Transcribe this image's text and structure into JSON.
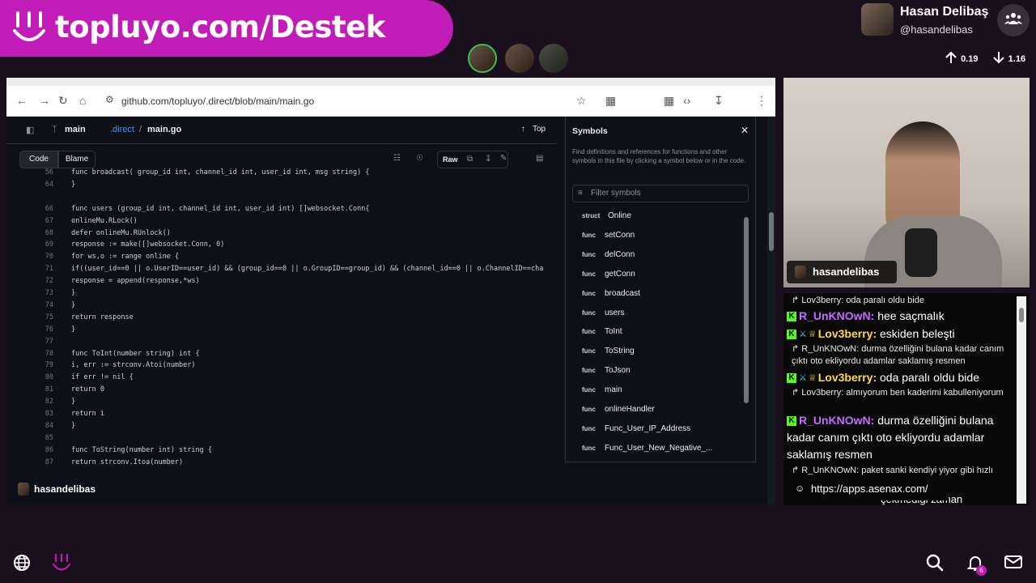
{
  "banner": {
    "text": "topluyo.com/Destek",
    "logo_icon": "topluyo-smile-icon"
  },
  "streamer": {
    "name": "Hasan Delibaş",
    "handle": "@hasandelibas"
  },
  "stats": {
    "upload": "0.19",
    "download": "1.16"
  },
  "browser": {
    "url": "github.com/topluyo/.direct/blob/main/main.go",
    "breadcrumb_repo": ".direct",
    "breadcrumb_file": "main.go",
    "branch": "main",
    "top_label": "Top",
    "code_tab": "Code",
    "blame_tab": "Blame",
    "raw_label": "Raw",
    "code_lines": [
      {
        "n": "56",
        "t": "func broadcast( group_id int, channel_id int, user_id int, msg string) {"
      },
      {
        "n": "64",
        "t": "}"
      },
      {
        "n": "",
        "t": ""
      },
      {
        "n": "66",
        "t": "func users (group_id int, channel_id int, user_id int) []websocket.Conn{"
      },
      {
        "n": "67",
        "t": "    onlineMu.RLock()"
      },
      {
        "n": "68",
        "t": "    defer onlineMu.RUnlock()"
      },
      {
        "n": "69",
        "t": "    response := make([]websocket.Conn, 0)"
      },
      {
        "n": "70",
        "t": "    for ws,o := range online {"
      },
      {
        "n": "71",
        "t": "        if((user_id==0 || o.UserID==user_id) && (group_id==0 || o.GroupID==group_id) && (channel_id==0 || o.ChannelID==cha"
      },
      {
        "n": "72",
        "t": "            response = append(response,*ws)"
      },
      {
        "n": "73",
        "t": "        }"
      },
      {
        "n": "74",
        "t": "    }"
      },
      {
        "n": "75",
        "t": "    return response"
      },
      {
        "n": "76",
        "t": "}"
      },
      {
        "n": "77",
        "t": ""
      },
      {
        "n": "78",
        "t": "func ToInt(number string) int {"
      },
      {
        "n": "79",
        "t": "    i, err := strconv.Atoi(number)"
      },
      {
        "n": "80",
        "t": "    if err != nil {"
      },
      {
        "n": "81",
        "t": "        return 0"
      },
      {
        "n": "82",
        "t": "    }"
      },
      {
        "n": "83",
        "t": "    return i"
      },
      {
        "n": "84",
        "t": "}"
      },
      {
        "n": "85",
        "t": ""
      },
      {
        "n": "86",
        "t": "func ToString(number int) string {"
      },
      {
        "n": "87",
        "t": "    return strconv.Itoa(number)"
      }
    ],
    "symbols": {
      "title": "Symbols",
      "description": "Find definitions and references for functions and other symbols in this file by clicking a symbol below or in the code.",
      "filter_placeholder": "Filter symbols",
      "items": [
        {
          "kind": "struct",
          "name": "Online"
        },
        {
          "kind": "func",
          "name": "setConn"
        },
        {
          "kind": "func",
          "name": "delConn"
        },
        {
          "kind": "func",
          "name": "getConn"
        },
        {
          "kind": "func",
          "name": "broadcast"
        },
        {
          "kind": "func",
          "name": "users"
        },
        {
          "kind": "func",
          "name": "ToInt"
        },
        {
          "kind": "func",
          "name": "ToString"
        },
        {
          "kind": "func",
          "name": "ToJson"
        },
        {
          "kind": "func",
          "name": "main"
        },
        {
          "kind": "func",
          "name": "onlineHandler"
        },
        {
          "kind": "func",
          "name": "Func_User_IP_Address"
        },
        {
          "kind": "func",
          "name": "Func_User_New_Negative_..."
        }
      ]
    },
    "screen_chip": "hasandelibas"
  },
  "camera": {
    "label": "hasandelibas"
  },
  "chat": {
    "r1": {
      "reply": "Lov3berry: oda paralı oldu bide"
    },
    "m1": {
      "user": "R_UnKNOwN:",
      "text": "hee saçmalık"
    },
    "m2": {
      "user": "Lov3berry:",
      "text": "eskiden beleşti"
    },
    "r2": {
      "reply": "R_UnKNOwN: durma özelliğini bulana kadar canım çıktı oto ekliyordu adamlar saklamış resmen"
    },
    "m3": {
      "user": "Lov3berry:",
      "text": "oda paralı oldu bide"
    },
    "r3": {
      "reply": "Lov3berry: almıyorum ben kaderimi kabulleniyorum"
    },
    "m4": {
      "user": "R_UnKNOwN:",
      "text": "durma özelliğini bulana kadar canım çıktı oto ekliyordu adamlar saklamış resmen"
    },
    "r4": {
      "reply": "R_UnKNOwN: paket sanki kendiyi yiyor gibi hızlı"
    },
    "m5": {
      "text": "çekmediği zaman"
    },
    "link": "https://apps.asenax.com/"
  },
  "bottom": {
    "notification_count": "6"
  }
}
